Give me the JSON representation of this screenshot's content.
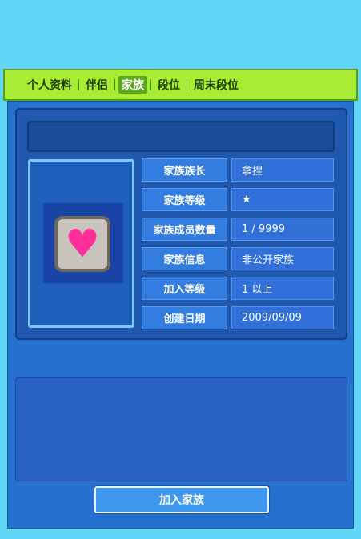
{
  "tabs": [
    "个人资料",
    "伴侣",
    "家族",
    "段位",
    "周末段位"
  ],
  "active_tab": "家族",
  "family": {
    "name": "",
    "rows": [
      {
        "label": "家族族长",
        "value": "拿捏"
      },
      {
        "label": "家族等级",
        "value": "★"
      },
      {
        "label": "家族成员数量",
        "value": "1 / 9999"
      },
      {
        "label": "家族信息",
        "value": "非公开家族"
      },
      {
        "label": "加入等级",
        "value": "1 以上"
      },
      {
        "label": "创建日期",
        "value": "2009/09/09"
      }
    ],
    "emblem_icon": "pink-heart-icon"
  },
  "description": "",
  "join_button": "加入家族"
}
